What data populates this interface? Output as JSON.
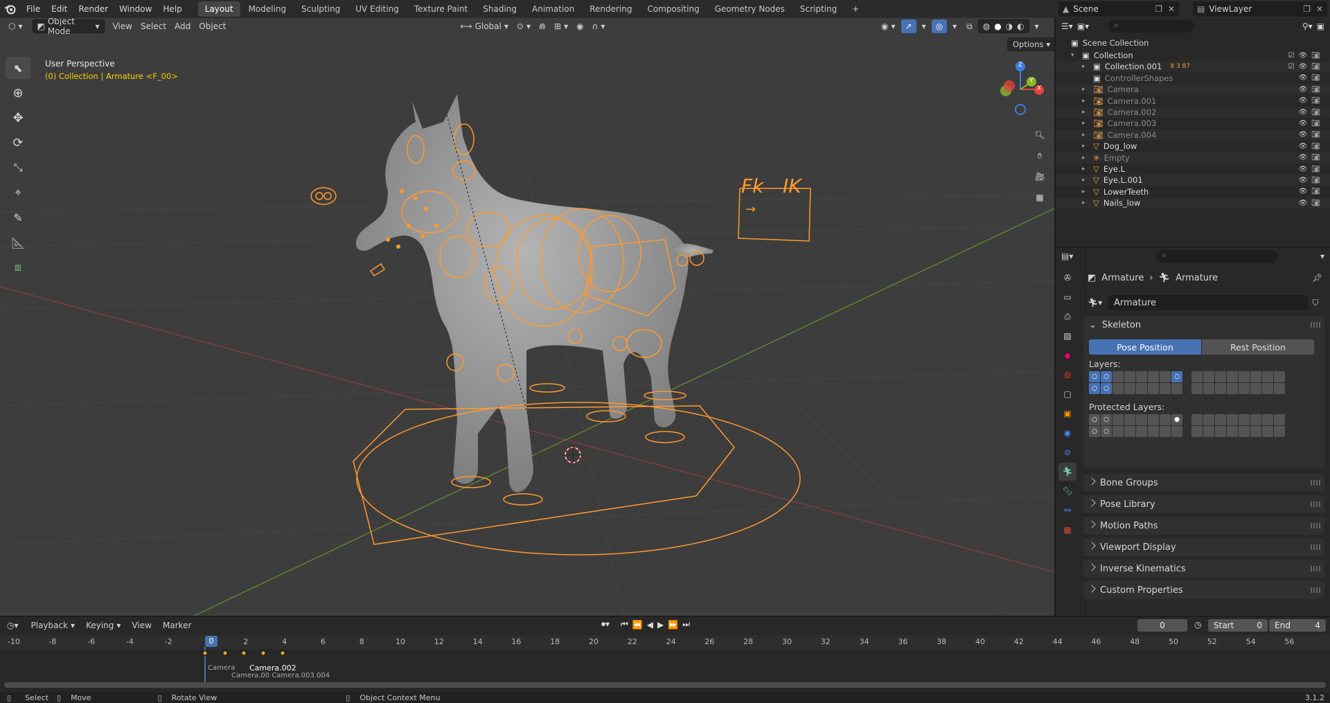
{
  "app": {
    "version": "3.1.2"
  },
  "menus": [
    "File",
    "Edit",
    "Render",
    "Window",
    "Help"
  ],
  "workspaces": [
    "Layout",
    "Modeling",
    "Sculpting",
    "UV Editing",
    "Texture Paint",
    "Shading",
    "Animation",
    "Rendering",
    "Compositing",
    "Geometry Nodes",
    "Scripting"
  ],
  "active_workspace": "Layout",
  "scene": {
    "name": "Scene",
    "view_layer": "ViewLayer"
  },
  "viewport": {
    "mode": "Object Mode",
    "menus": [
      "View",
      "Select",
      "Add",
      "Object"
    ],
    "transform": "Global",
    "options_label": "Options",
    "overlay_title": "User Perspective",
    "overlay_subtitle": "(0) Collection | Armature <F_00>",
    "fkik": {
      "fk": "Fk",
      "ik": "IK"
    },
    "axes": {
      "x": "X",
      "y": "Y",
      "z": "Z"
    }
  },
  "outliner": {
    "scene_collection": "Scene Collection",
    "rows": [
      {
        "name": "Collection",
        "badge": ""
      },
      {
        "name": "Collection.001",
        "badge": "8 3 87"
      },
      {
        "name": "ControllerShapes",
        "badge": ""
      },
      {
        "name": "Camera",
        "badge": ""
      },
      {
        "name": "Camera.001",
        "badge": ""
      },
      {
        "name": "Camera.002",
        "badge": ""
      },
      {
        "name": "Camera.003",
        "badge": ""
      },
      {
        "name": "Camera.004",
        "badge": ""
      },
      {
        "name": "Dog_low",
        "badge": ""
      },
      {
        "name": "Empty",
        "badge": ""
      },
      {
        "name": "Eye.L",
        "badge": ""
      },
      {
        "name": "Eye.L.001",
        "badge": ""
      },
      {
        "name": "LowerTeeth",
        "badge": ""
      },
      {
        "name": "Nails_low",
        "badge": ""
      }
    ]
  },
  "properties": {
    "breadcrumb": [
      "Armature",
      "Armature"
    ],
    "data_name": "Armature",
    "skeleton": "Skeleton",
    "pose_position": "Pose Position",
    "rest_position": "Rest Position",
    "layers_label": "Layers:",
    "protected_label": "Protected Layers:",
    "panels": [
      "Bone Groups",
      "Pose Library",
      "Motion Paths",
      "Viewport Display",
      "Inverse Kinematics",
      "Custom Properties"
    ]
  },
  "timeline": {
    "menus": [
      "Playback",
      "Keying",
      "View",
      "Marker"
    ],
    "current_frame": "0",
    "start_label": "Start",
    "start": "0",
    "end_label": "End",
    "end": "4",
    "ticks": [
      "-10",
      "-8",
      "-6",
      "-4",
      "-2",
      "0",
      "2",
      "4",
      "6",
      "8",
      "10",
      "12",
      "14",
      "16",
      "18",
      "20",
      "22",
      "24",
      "26",
      "28",
      "30",
      "32",
      "34",
      "36",
      "38",
      "40",
      "42",
      "44",
      "46",
      "48",
      "50",
      "52",
      "54",
      "56"
    ],
    "markers_line1": "Camera",
    "markers_active": "Camera.002",
    "markers_line2": "Camera.00 Camera.003.004"
  },
  "status": {
    "select": "Select",
    "move": "Move",
    "rotate": "Rotate View",
    "context": "Object Context Menu"
  },
  "colors": {
    "accent": "#4772b3",
    "rig": "#ff9a2e",
    "active_text": "#ffcc00"
  }
}
